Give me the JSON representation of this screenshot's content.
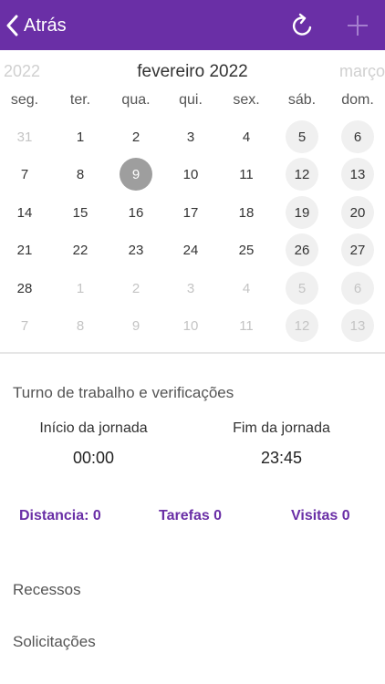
{
  "header": {
    "back_label": "Atrás",
    "background": "#6a2fa6",
    "refresh_icon": "refresh-icon",
    "add_icon": "plus-icon"
  },
  "calendar": {
    "prev_month": "2022",
    "current_month": "fevereiro 2022",
    "next_month": "março",
    "weekdays": [
      "seg.",
      "ter.",
      "qua.",
      "qui.",
      "sex.",
      "sáb.",
      "dom."
    ],
    "selected_day": "9",
    "weeks": [
      [
        {
          "d": "31",
          "o": true
        },
        {
          "d": "1"
        },
        {
          "d": "2"
        },
        {
          "d": "3"
        },
        {
          "d": "4"
        },
        {
          "d": "5"
        },
        {
          "d": "6"
        }
      ],
      [
        {
          "d": "7"
        },
        {
          "d": "8"
        },
        {
          "d": "9",
          "s": true
        },
        {
          "d": "10"
        },
        {
          "d": "11"
        },
        {
          "d": "12"
        },
        {
          "d": "13"
        }
      ],
      [
        {
          "d": "14"
        },
        {
          "d": "15"
        },
        {
          "d": "16"
        },
        {
          "d": "17"
        },
        {
          "d": "18"
        },
        {
          "d": "19"
        },
        {
          "d": "20"
        }
      ],
      [
        {
          "d": "21"
        },
        {
          "d": "22"
        },
        {
          "d": "23"
        },
        {
          "d": "24"
        },
        {
          "d": "25"
        },
        {
          "d": "26"
        },
        {
          "d": "27"
        }
      ],
      [
        {
          "d": "28"
        },
        {
          "d": "1",
          "o": true
        },
        {
          "d": "2",
          "o": true
        },
        {
          "d": "3",
          "o": true
        },
        {
          "d": "4",
          "o": true
        },
        {
          "d": "5",
          "o": true
        },
        {
          "d": "6",
          "o": true
        }
      ],
      [
        {
          "d": "7",
          "o": true
        },
        {
          "d": "8",
          "o": true
        },
        {
          "d": "9",
          "o": true
        },
        {
          "d": "10",
          "o": true
        },
        {
          "d": "11",
          "o": true
        },
        {
          "d": "12",
          "o": true
        },
        {
          "d": "13",
          "o": true
        }
      ]
    ]
  },
  "shift": {
    "title": "Turno de trabalho e verificações",
    "start_label": "Início da jornada",
    "start_value": "00:00",
    "end_label": "Fim da jornada",
    "end_value": "23:45"
  },
  "stats": {
    "distance": "Distancia: 0",
    "tasks": "Tarefas 0",
    "visits": "Visitas 0"
  },
  "sections": {
    "breaks": "Recessos",
    "requests": "Solicitações"
  }
}
